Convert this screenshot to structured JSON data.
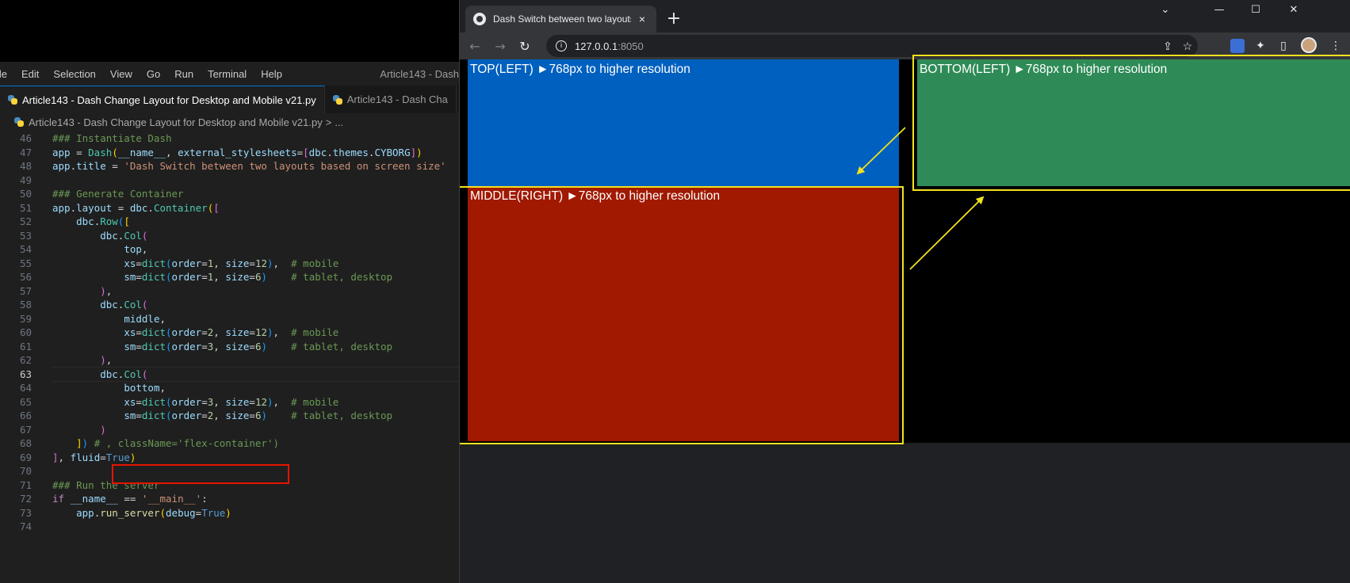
{
  "vscode": {
    "menu": [
      "File",
      "Edit",
      "Selection",
      "View",
      "Go",
      "Run",
      "Terminal",
      "Help"
    ],
    "menu_visible": [
      "ile",
      "Edit",
      "Selection",
      "View",
      "Go",
      "Run",
      "Terminal",
      "Help"
    ],
    "window_title": "Article143 - Dash",
    "tabs": [
      {
        "label": "Article143 - Dash Change Layout for Desktop and Mobile v21.py",
        "active": true
      },
      {
        "label": "Article143 - Dash Cha",
        "active": false
      }
    ],
    "breadcrumb": {
      "file": "Article143 - Dash Change Layout for Desktop and Mobile v21.py",
      "sep": ">",
      "more": "..."
    },
    "current_line": 63,
    "code": [
      {
        "n": "46",
        "t": [
          [
            "com",
            "### Instantiate Dash"
          ]
        ]
      },
      {
        "n": "47",
        "t": [
          [
            "var",
            "app"
          ],
          [
            "op",
            " = "
          ],
          [
            "cls",
            "Dash"
          ],
          [
            "br1",
            "("
          ],
          [
            "var",
            "__name__"
          ],
          [
            "op",
            ", "
          ],
          [
            "var",
            "external_stylesheets"
          ],
          [
            "op",
            "="
          ],
          [
            "br2",
            "["
          ],
          [
            "var",
            "dbc"
          ],
          [
            "op",
            "."
          ],
          [
            "var",
            "themes"
          ],
          [
            "op",
            "."
          ],
          [
            "var",
            "CYBORG"
          ],
          [
            "br2",
            "]"
          ],
          [
            "br1",
            ")"
          ]
        ]
      },
      {
        "n": "48",
        "t": [
          [
            "var",
            "app"
          ],
          [
            "op",
            "."
          ],
          [
            "var",
            "title"
          ],
          [
            "op",
            " = "
          ],
          [
            "str",
            "'Dash Switch between two layouts based on screen size'"
          ]
        ]
      },
      {
        "n": "49",
        "t": []
      },
      {
        "n": "50",
        "t": [
          [
            "com",
            "### Generate Container"
          ]
        ]
      },
      {
        "n": "51",
        "t": [
          [
            "var",
            "app"
          ],
          [
            "op",
            "."
          ],
          [
            "var",
            "layout"
          ],
          [
            "op",
            " = "
          ],
          [
            "var",
            "dbc"
          ],
          [
            "op",
            "."
          ],
          [
            "cls",
            "Container"
          ],
          [
            "br1",
            "("
          ],
          [
            "br2",
            "["
          ]
        ]
      },
      {
        "n": "52",
        "t": [
          [
            "op",
            "    "
          ],
          [
            "var",
            "dbc"
          ],
          [
            "op",
            "."
          ],
          [
            "cls",
            "Row"
          ],
          [
            "br3",
            "("
          ],
          [
            "br1",
            "["
          ]
        ]
      },
      {
        "n": "53",
        "t": [
          [
            "op",
            "        "
          ],
          [
            "var",
            "dbc"
          ],
          [
            "op",
            "."
          ],
          [
            "cls",
            "Col"
          ],
          [
            "br2",
            "("
          ]
        ]
      },
      {
        "n": "54",
        "t": [
          [
            "op",
            "            "
          ],
          [
            "var",
            "top"
          ],
          [
            "op",
            ","
          ]
        ]
      },
      {
        "n": "55",
        "t": [
          [
            "op",
            "            "
          ],
          [
            "var",
            "xs"
          ],
          [
            "op",
            "="
          ],
          [
            "cls",
            "dict"
          ],
          [
            "br3",
            "("
          ],
          [
            "var",
            "order"
          ],
          [
            "op",
            "="
          ],
          [
            "num",
            "1"
          ],
          [
            "op",
            ", "
          ],
          [
            "var",
            "size"
          ],
          [
            "op",
            "="
          ],
          [
            "num",
            "12"
          ],
          [
            "br3",
            ")"
          ],
          [
            "op",
            ",  "
          ],
          [
            "com",
            "# mobile"
          ]
        ]
      },
      {
        "n": "56",
        "t": [
          [
            "op",
            "            "
          ],
          [
            "var",
            "sm"
          ],
          [
            "op",
            "="
          ],
          [
            "cls",
            "dict"
          ],
          [
            "br3",
            "("
          ],
          [
            "var",
            "order"
          ],
          [
            "op",
            "="
          ],
          [
            "num",
            "1"
          ],
          [
            "op",
            ", "
          ],
          [
            "var",
            "size"
          ],
          [
            "op",
            "="
          ],
          [
            "num",
            "6"
          ],
          [
            "br3",
            ")"
          ],
          [
            "op",
            "    "
          ],
          [
            "com",
            "# tablet, desktop"
          ]
        ]
      },
      {
        "n": "57",
        "t": [
          [
            "op",
            "        "
          ],
          [
            "br2",
            ")"
          ],
          [
            "op",
            ","
          ]
        ]
      },
      {
        "n": "58",
        "t": [
          [
            "op",
            "        "
          ],
          [
            "var",
            "dbc"
          ],
          [
            "op",
            "."
          ],
          [
            "cls",
            "Col"
          ],
          [
            "br2",
            "("
          ]
        ]
      },
      {
        "n": "59",
        "t": [
          [
            "op",
            "            "
          ],
          [
            "var",
            "middle"
          ],
          [
            "op",
            ","
          ]
        ]
      },
      {
        "n": "60",
        "t": [
          [
            "op",
            "            "
          ],
          [
            "var",
            "xs"
          ],
          [
            "op",
            "="
          ],
          [
            "cls",
            "dict"
          ],
          [
            "br3",
            "("
          ],
          [
            "var",
            "order"
          ],
          [
            "op",
            "="
          ],
          [
            "num",
            "2"
          ],
          [
            "op",
            ", "
          ],
          [
            "var",
            "size"
          ],
          [
            "op",
            "="
          ],
          [
            "num",
            "12"
          ],
          [
            "br3",
            ")"
          ],
          [
            "op",
            ",  "
          ],
          [
            "com",
            "# mobile"
          ]
        ]
      },
      {
        "n": "61",
        "t": [
          [
            "op",
            "            "
          ],
          [
            "var",
            "sm"
          ],
          [
            "op",
            "="
          ],
          [
            "cls",
            "dict"
          ],
          [
            "br3",
            "("
          ],
          [
            "var",
            "order"
          ],
          [
            "op",
            "="
          ],
          [
            "num",
            "3"
          ],
          [
            "op",
            ", "
          ],
          [
            "var",
            "size"
          ],
          [
            "op",
            "="
          ],
          [
            "num",
            "6"
          ],
          [
            "br3",
            ")"
          ],
          [
            "op",
            "    "
          ],
          [
            "com",
            "# tablet, desktop"
          ]
        ]
      },
      {
        "n": "62",
        "t": [
          [
            "op",
            "        "
          ],
          [
            "br2",
            ")"
          ],
          [
            "op",
            ","
          ]
        ]
      },
      {
        "n": "63",
        "t": [
          [
            "op",
            "        "
          ],
          [
            "var",
            "dbc"
          ],
          [
            "op",
            "."
          ],
          [
            "cls",
            "Col"
          ],
          [
            "br2",
            "("
          ]
        ]
      },
      {
        "n": "64",
        "t": [
          [
            "op",
            "            "
          ],
          [
            "var",
            "bottom"
          ],
          [
            "op",
            ","
          ]
        ]
      },
      {
        "n": "65",
        "t": [
          [
            "op",
            "            "
          ],
          [
            "var",
            "xs"
          ],
          [
            "op",
            "="
          ],
          [
            "cls",
            "dict"
          ],
          [
            "br3",
            "("
          ],
          [
            "var",
            "order"
          ],
          [
            "op",
            "="
          ],
          [
            "num",
            "3"
          ],
          [
            "op",
            ", "
          ],
          [
            "var",
            "size"
          ],
          [
            "op",
            "="
          ],
          [
            "num",
            "12"
          ],
          [
            "br3",
            ")"
          ],
          [
            "op",
            ",  "
          ],
          [
            "com",
            "# mobile"
          ]
        ]
      },
      {
        "n": "66",
        "t": [
          [
            "op",
            "            "
          ],
          [
            "var",
            "sm"
          ],
          [
            "op",
            "="
          ],
          [
            "cls",
            "dict"
          ],
          [
            "br3",
            "("
          ],
          [
            "var",
            "order"
          ],
          [
            "op",
            "="
          ],
          [
            "num",
            "2"
          ],
          [
            "op",
            ", "
          ],
          [
            "var",
            "size"
          ],
          [
            "op",
            "="
          ],
          [
            "num",
            "6"
          ],
          [
            "br3",
            ")"
          ],
          [
            "op",
            "    "
          ],
          [
            "com",
            "# tablet, desktop"
          ]
        ]
      },
      {
        "n": "67",
        "t": [
          [
            "op",
            "        "
          ],
          [
            "br2",
            ")"
          ]
        ]
      },
      {
        "n": "68",
        "t": [
          [
            "op",
            "    "
          ],
          [
            "br1",
            "]"
          ],
          [
            "br3",
            ")"
          ],
          [
            "op",
            " "
          ],
          [
            "com",
            "# , className='flex-container')"
          ]
        ]
      },
      {
        "n": "69",
        "t": [
          [
            "br2",
            "]"
          ],
          [
            "op",
            ", "
          ],
          [
            "var",
            "fluid"
          ],
          [
            "op",
            "="
          ],
          [
            "kw",
            "True"
          ],
          [
            "br1",
            ")"
          ]
        ]
      },
      {
        "n": "70",
        "t": []
      },
      {
        "n": "71",
        "t": [
          [
            "com",
            "### Run the server"
          ]
        ]
      },
      {
        "n": "72",
        "t": [
          [
            "ctl",
            "if"
          ],
          [
            "op",
            " "
          ],
          [
            "var",
            "__name__"
          ],
          [
            "op",
            " == "
          ],
          [
            "str",
            "'__main__'"
          ],
          [
            "op",
            ":"
          ]
        ]
      },
      {
        "n": "73",
        "t": [
          [
            "op",
            "    "
          ],
          [
            "var",
            "app"
          ],
          [
            "op",
            "."
          ],
          [
            "fn",
            "run_server"
          ],
          [
            "br1",
            "("
          ],
          [
            "var",
            "debug"
          ],
          [
            "op",
            "="
          ],
          [
            "kw",
            "True"
          ],
          [
            "br1",
            ")"
          ]
        ]
      },
      {
        "n": "74",
        "t": []
      }
    ]
  },
  "chrome": {
    "tab_title": "Dash Switch between two layouts based on screen size",
    "tab_close": "×",
    "new_tab": "+",
    "window_controls": {
      "dropdown": "⌄",
      "minimize": "—",
      "maximize": "☐",
      "close": "✕"
    },
    "nav": {
      "back": "←",
      "forward": "→",
      "reload": "↻"
    },
    "url_host": "127.0.0.1",
    "url_port": ":8050",
    "omnibox_icons": {
      "share": "⇪",
      "bookmark": "☆"
    },
    "toolbar_icons": {
      "puzzle": "✦",
      "sidepanel": "▯",
      "menu": "⋮"
    }
  },
  "dash_page": {
    "top_label": "TOP(LEFT)  ►768px to higher resolution",
    "bottom_label": "BOTTOM(LEFT)  ►768px to higher resolution",
    "middle_label": "MIDDLE(RIGHT)  ►768px to higher resolution",
    "colors": {
      "top": "#0060bf",
      "bottom": "#2e8b57",
      "middle": "#a01900",
      "annotation": "#f2e21e",
      "highlight": "#e51400"
    }
  }
}
